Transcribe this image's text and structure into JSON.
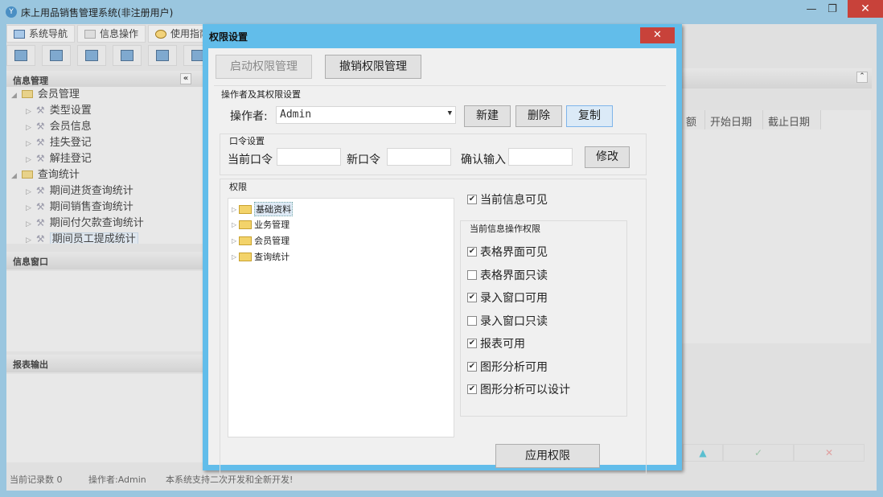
{
  "app": {
    "title": "床上用品销售管理系统(非注册用户)"
  },
  "tabs": [
    "系统导航",
    "信息操作",
    "使用指南"
  ],
  "left": {
    "info_header": "信息管理",
    "collapse": "«",
    "tree": [
      {
        "label": "会员管理",
        "level": 0
      },
      {
        "label": "类型设置",
        "level": 1
      },
      {
        "label": "会员信息",
        "level": 1
      },
      {
        "label": "挂失登记",
        "level": 1
      },
      {
        "label": "解挂登记",
        "level": 1
      },
      {
        "label": "查询统计",
        "level": 0
      },
      {
        "label": "期间进货查询统计",
        "level": 1
      },
      {
        "label": "期间销售查询统计",
        "level": 1
      },
      {
        "label": "期间付欠款查询统计",
        "level": 1
      },
      {
        "label": "期间员工提成统计",
        "level": 1,
        "selected": true
      }
    ],
    "window_header": "信息窗口",
    "report_header": "报表输出"
  },
  "grid": {
    "columns": [
      "额",
      "开始日期",
      "截止日期"
    ]
  },
  "status": {
    "records": "当前记录数 0",
    "operator": "操作者:Admin",
    "notice": "本系统支持二次开发和全新开发!"
  },
  "dialog": {
    "title": "权限设置",
    "close": "✕",
    "start_btn": "启动权限管理",
    "revoke_btn": "撤销权限管理",
    "section_operator": "操作者及其权限设置",
    "operator_label": "操作者:",
    "operator_value": "Admin",
    "new_btn": "新建",
    "delete_btn": "删除",
    "copy_btn": "复制",
    "password_group": "口令设置",
    "current_pwd": "当前口令",
    "new_pwd": "新口令",
    "confirm_pwd": "确认输入",
    "modify_btn": "修改",
    "perm_group": "权限",
    "perm_tree": [
      "基础资料",
      "业务管理",
      "会员管理",
      "查询统计"
    ],
    "visible": {
      "label": "当前信息可见",
      "checked": true
    },
    "ops_group": "当前信息操作权限",
    "ops": [
      {
        "label": "表格界面可见",
        "checked": true
      },
      {
        "label": "表格界面只读",
        "checked": false
      },
      {
        "label": "录入窗口可用",
        "checked": true
      },
      {
        "label": "录入窗口只读",
        "checked": false
      },
      {
        "label": "报表可用",
        "checked": true
      },
      {
        "label": "图形分析可用",
        "checked": true
      },
      {
        "label": "图形分析可以设计",
        "checked": true
      }
    ],
    "apply_btn": "应用权限"
  }
}
